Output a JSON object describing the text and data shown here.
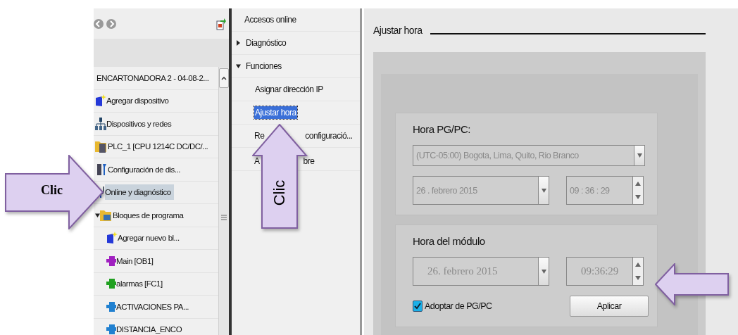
{
  "project_tree": {
    "title": "ENCARTONADORA 2 - 04-08-2...",
    "items": [
      {
        "label": "Agregar dispositivo",
        "kind": "add",
        "selected": false
      },
      {
        "label": "Dispositivos y redes",
        "kind": "network",
        "selected": false
      },
      {
        "label": "PLC_1 [CPU 1214C DC/DC/...",
        "kind": "plc",
        "selected": false,
        "children": [
          {
            "label": "Configuración de dis...",
            "kind": "config",
            "selected": false
          },
          {
            "label": "Online y diagnóstico",
            "kind": "online",
            "selected": true
          },
          {
            "label": "Bloques de programa",
            "kind": "folder",
            "selected": false,
            "expanded": true,
            "children": [
              {
                "label": "Agregar nuevo bl...",
                "kind": "add",
                "selected": false
              },
              {
                "label": "Main [OB1]",
                "kind": "block",
                "color": "#a020c0",
                "selected": false
              },
              {
                "label": "alarmas [FC1]",
                "kind": "block",
                "color": "#20a020",
                "selected": false
              },
              {
                "label": "ACTIVACIONES PA...",
                "kind": "block",
                "color": "#2080d0",
                "selected": false
              },
              {
                "label": "DISTANCIA_ENCO",
                "kind": "block",
                "color": "#2080d0",
                "selected": false
              }
            ]
          }
        ]
      }
    ]
  },
  "online_nav": [
    {
      "label": "Accesos online",
      "selected": false
    },
    {
      "label": "Diagnóstico",
      "expanded": false,
      "selected": false
    },
    {
      "label": "Funciones",
      "expanded": true,
      "selected": false,
      "children": [
        {
          "label": "Asignar dirección IP",
          "selected": false
        },
        {
          "label": "Ajustar hora",
          "selected": true
        },
        {
          "parts": [
            "Re",
            "configuració..."
          ]
        },
        {
          "parts": [
            "A",
            "bre"
          ]
        }
      ]
    }
  ],
  "settings": {
    "title": "Ajustar hora",
    "pg_pc": {
      "title": "Hora PG/PC:",
      "timezone": "(UTC-05:00) Bogota, Lima, Quito, Rio Branco",
      "date": "26 . febrero  2015",
      "time": "09 : 36 : 29",
      "disabled": true
    },
    "module": {
      "title": "Hora del módulo",
      "date": "26. febrero 2015",
      "time": "09:36:29",
      "disabled": true,
      "adopt": {
        "label": "Adoptar de PG/PC",
        "checked": true
      },
      "apply": "Aplicar"
    }
  },
  "annotations": [
    {
      "kind": "right-arrow",
      "label": "Clic"
    },
    {
      "kind": "up-arrow",
      "label": "Clic"
    },
    {
      "kind": "left-arrow"
    }
  ]
}
